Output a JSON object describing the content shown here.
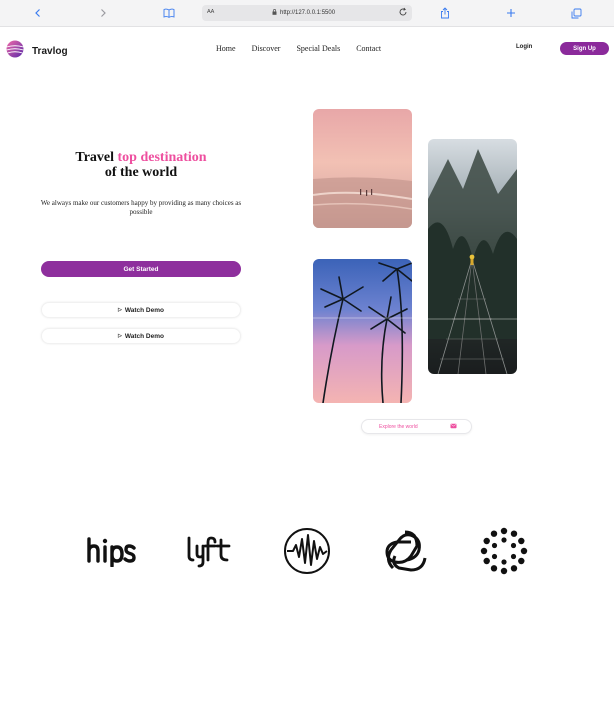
{
  "browser": {
    "text_size_label": "AA",
    "url": "http://127.0.0.1:5500"
  },
  "brand": {
    "name": "Travlog"
  },
  "nav": {
    "items": [
      {
        "label": "Home"
      },
      {
        "label": "Discover"
      },
      {
        "label": "Special Deals"
      },
      {
        "label": "Contact"
      }
    ],
    "login_label": "Login",
    "signup_label": "Sign Up"
  },
  "hero": {
    "title_prefix": "Travel",
    "title_accent": "top destination",
    "title_suffix": "of the world",
    "subtitle": "We always make our customers happy by providing as many choices as possible",
    "get_started_label": "Get Started",
    "watch_demo_label_1": "Watch Demo",
    "watch_demo_label_2": "Watch Demo",
    "explore_label": "Explore the world"
  },
  "partners": {
    "logos": [
      {
        "icon": "hips-logo"
      },
      {
        "icon": "lyft-logo"
      },
      {
        "icon": "wave-logo"
      },
      {
        "icon": "knot-logo"
      },
      {
        "icon": "dots-circle-logo"
      }
    ]
  },
  "colors": {
    "accent_pink": "#ee4f9f",
    "primary_purple": "#8e2f9d"
  }
}
